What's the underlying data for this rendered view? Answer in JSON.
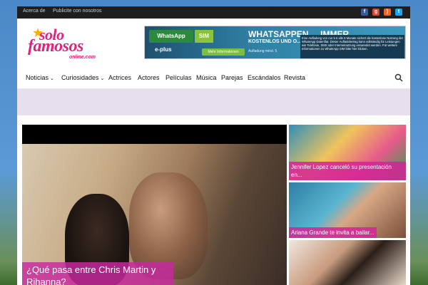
{
  "topbar": {
    "links": [
      "Acerca de",
      "Publicite con nosotros"
    ],
    "social_icons": [
      {
        "name": "facebook-icon",
        "color": "#3b5998",
        "glyph": "f"
      },
      {
        "name": "googleplus-icon",
        "color": "#d34836",
        "glyph": "g+"
      },
      {
        "name": "rss-icon",
        "color": "#f26522",
        "glyph": "⌁"
      },
      {
        "name": "twitter-icon",
        "color": "#1da1f2",
        "glyph": "t"
      }
    ]
  },
  "logo": {
    "line1": "solo",
    "line2": "famosos",
    "line3": "online.com"
  },
  "ad": {
    "whatsapp_label": "WhatsApp",
    "sim_label": "SIM",
    "eplus_label": "e-plus",
    "info_button": "Mehr Informationen",
    "headline": "WHATSAPPEN ... IMMER",
    "subline": "KOSTENLOS UND O...",
    "small": "Aufladung mind. 5",
    "fine_print": "Eine Aufladung von nur 5 € alle 6 Monate sichert die kostenlose Nutzung der WhatsApp Datenflat. Dieser Aufladebetrag kann vollständig für Leistungen wie Telefonie, SMS oder Internetnutzung verwendet werden. Für weitere Informationen zu WhatsApp SIM bitte hier klicken."
  },
  "nav": {
    "items": [
      {
        "label": "Noticias",
        "dropdown": true
      },
      {
        "label": "Curiosidades",
        "dropdown": true
      },
      {
        "label": "Actrices",
        "dropdown": false
      },
      {
        "label": "Actores",
        "dropdown": false
      },
      {
        "label": "Películas",
        "dropdown": false
      },
      {
        "label": "Música",
        "dropdown": false
      },
      {
        "label": "Parejas",
        "dropdown": false
      },
      {
        "label": "Escándalos",
        "dropdown": false
      },
      {
        "label": "Revista",
        "dropdown": false
      }
    ],
    "search_icon": "search-icon"
  },
  "hero": {
    "caption": "¿Qué pasa entre Chris Martin y Rihanna?"
  },
  "sidebar": {
    "items": [
      {
        "caption": "Jennifer Lopez canceló su presentación en..."
      },
      {
        "caption": "Ariana Grande te invita a bailar..."
      },
      {
        "caption": ""
      }
    ]
  }
}
